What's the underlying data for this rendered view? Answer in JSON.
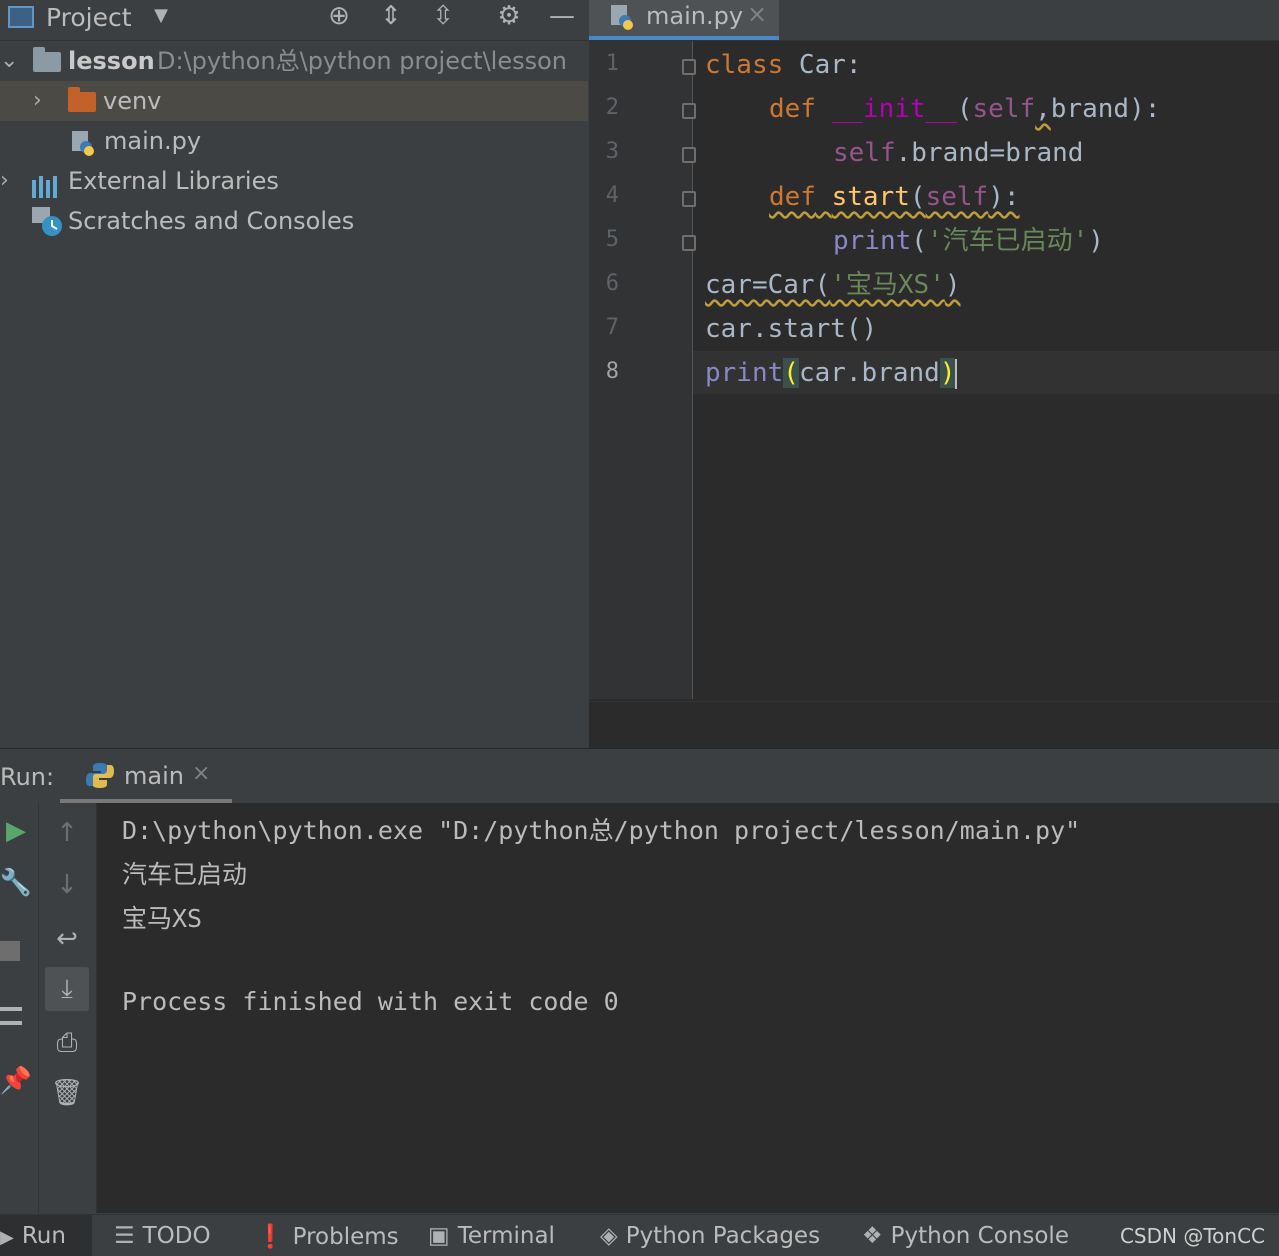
{
  "project_panel": {
    "title": "Project",
    "tree": [
      {
        "label": "lesson",
        "path": "D:\\python总\\python project\\lesson"
      },
      {
        "label": "venv"
      },
      {
        "label": "main.py"
      },
      {
        "label": "External Libraries"
      },
      {
        "label": "Scratches and Consoles"
      }
    ]
  },
  "editor": {
    "tab_label": "main.py",
    "line_numbers": [
      "1",
      "2",
      "3",
      "4",
      "5",
      "6",
      "7",
      "8"
    ],
    "lines": [
      {
        "kw": "class",
        "rest": " Car:"
      },
      {
        "kw": "def",
        "fn": "__init__",
        "p1": "(",
        "self": "self",
        "p2": ",",
        "p3": "brand):"
      },
      {
        "self": "self",
        "p1": ".brand=brand"
      },
      {
        "kw": "def",
        "fn": "start",
        "p1": "(",
        "self": "self",
        "p2": "):"
      },
      {
        "builtin": "print",
        "p1": "(",
        "str": "'汽车已启动'",
        "p2": ")"
      },
      {
        "p1": "car=Car(",
        "str": "'宝马XS'",
        "p2": ")"
      },
      {
        "p1": "car.start()"
      },
      {
        "builtin": "print",
        "p1": "(",
        "p2": "car.brand",
        "p3": ")"
      }
    ]
  },
  "run_panel": {
    "label": "Run:",
    "tab_label": "main",
    "output": [
      "D:\\python\\python.exe \"D:/python总/python project/lesson/main.py\"",
      "汽车已启动",
      "宝马XS",
      "",
      "Process finished with exit code 0"
    ]
  },
  "status_bar": {
    "items": [
      "Run",
      "TODO",
      "Problems",
      "Terminal",
      "Python Packages",
      "Python Console"
    ],
    "watermark": "CSDN @TonCC"
  },
  "colors": {
    "keyword": "#cc7832",
    "function": "#ffc66d",
    "self": "#94558d",
    "string": "#6a8759",
    "builtin": "#8888c6",
    "accent": "#4a88c7"
  }
}
